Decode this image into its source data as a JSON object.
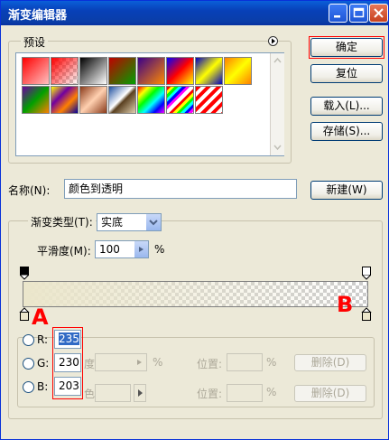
{
  "window": {
    "title": "渐变编辑器"
  },
  "presets_label": "预设",
  "buttons": {
    "ok": "确定",
    "reset": "复位",
    "load": "载入(L)...",
    "save": "存储(S)...",
    "new": "新建(W)",
    "delete1": "删除(D)",
    "delete2": "删除(D)"
  },
  "name": {
    "label": "名称(N):",
    "value": "颜色到透明"
  },
  "gradient_type": {
    "label": "渐变类型(T):",
    "value": "实底"
  },
  "smoothness": {
    "label": "平滑度(M):",
    "value": "100",
    "unit": "%"
  },
  "annotations": {
    "a": "A",
    "b": "B"
  },
  "color": {
    "r_label": "R:",
    "r_value": "235",
    "g_label": "G:",
    "g_value": "230",
    "b_label": "B:",
    "b_value": "203"
  },
  "stops": {
    "opacity_partial": "度:",
    "color_partial": "色:",
    "pct1": "%",
    "pct2": "%",
    "pct3": "%",
    "pos1": "位置:",
    "pos2": "位置:"
  },
  "preset_swatches": [
    "red-gradient",
    "red-transparent",
    "black-white",
    "red-green",
    "violet-orange",
    "blue-red-yellow",
    "blue-yellow-blue",
    "orange-yellow-orange",
    "violet-green-orange",
    "yellow-violet-orange-blue",
    "copper",
    "chrome",
    "spectrum",
    "transparent-rainbow",
    "transparent-stripes"
  ],
  "colors": {
    "title_bg": "#0a5fd8",
    "dialog_bg": "#ece9d8",
    "stop_color": "#ebe6cb",
    "annotation": "#ff0000"
  }
}
